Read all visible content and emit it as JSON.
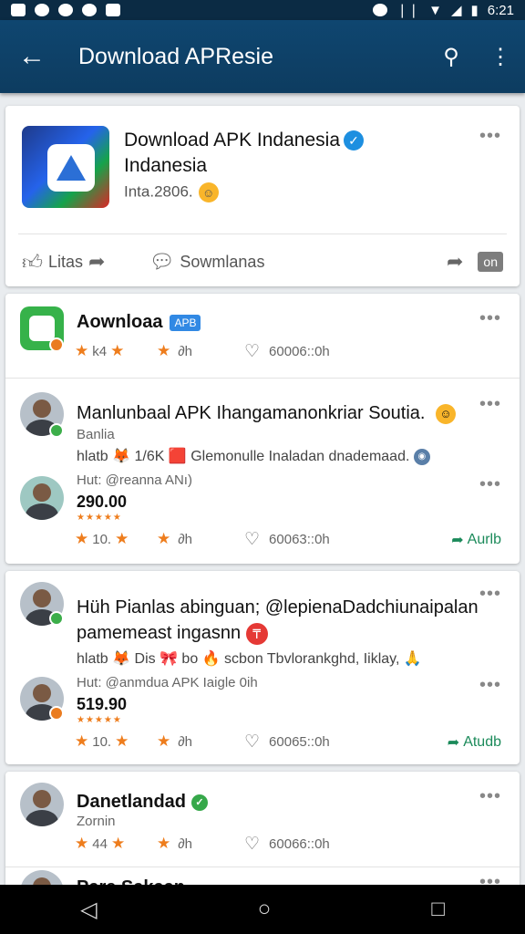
{
  "status": {
    "time": "6:21"
  },
  "appbar": {
    "title": "Download APResie",
    "back_icon": "arrow-left-icon",
    "search_icon": "search-icon",
    "more_icon": "more-vert-icon"
  },
  "hero": {
    "title_line1": "Download APK Indanesia",
    "title_line2": "Indanesia",
    "subtitle": "Inta.2806.",
    "like_label": "Litas",
    "comment_label": "Sowmlanas",
    "on_label": "on"
  },
  "posts": [
    {
      "name": "Aownloaa",
      "tag": "APB",
      "rating": "k4",
      "time": "∂h",
      "stat": "60006::0h"
    },
    {
      "name": "Manlunbaal APK Ihangamanonkriar Soutia.",
      "sub": "Banlia",
      "line": "hlatb 🦊 1/6K 🟥 Glemonulle Inaladan dnademaad.",
      "handle": "Hut: @reanna ANı)",
      "price": "290.00",
      "stars": "★★★★★",
      "rating": "10.",
      "time": "∂h",
      "stat": "60063::0h",
      "action": "Aurlb"
    },
    {
      "name": "Hüh Pianlas abinguan; @lepienaDadchiunaipalan pamemeast ingasnn",
      "line": "hlatb 🦊 Dis 🎀 bo 🔥 scbon Tbvlorankghd, Iiklay, 🙏",
      "handle": "Hut: @anmdua APK Iaigle 0ih",
      "price": "519.90",
      "stars": "★★★★★",
      "rating": "10.",
      "time": "∂h",
      "stat": "60065::0h",
      "action": "Atudb"
    },
    {
      "name": "Danetlandad",
      "sub": "Zornin",
      "rating": "44",
      "time": "∂h",
      "stat": "60066::0h"
    },
    {
      "name": "Pare Sakaan"
    }
  ]
}
